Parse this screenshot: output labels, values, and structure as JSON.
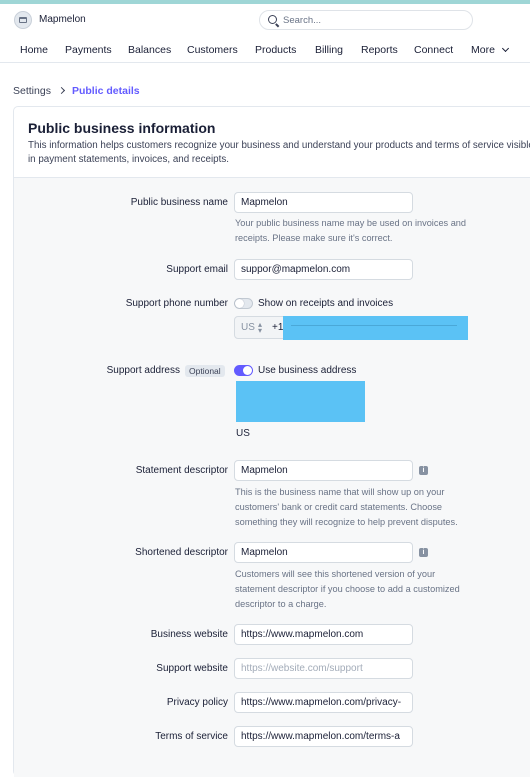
{
  "account": {
    "name": "Mapmelon"
  },
  "search": {
    "placeholder": "Search..."
  },
  "nav": {
    "items": [
      "Home",
      "Payments",
      "Balances",
      "Customers",
      "Products",
      "Billing",
      "Reports",
      "Connect"
    ],
    "more_label": "More"
  },
  "breadcrumb": {
    "parent": "Settings",
    "current": "Public details"
  },
  "card": {
    "title": "Public business information",
    "description": "This information helps customers recognize your business and understand your products and terms of service visible in payment statements, invoices, and receipts."
  },
  "form": {
    "business_name": {
      "label": "Public business name",
      "value": "Mapmelon",
      "help": "Your public business name may be used on invoices and receipts. Please make sure it's correct."
    },
    "support_email": {
      "label": "Support email",
      "value": "suppor@mapmelon.com"
    },
    "support_phone": {
      "label": "Support phone number",
      "toggle_label": "Show on receipts and invoices",
      "toggle_on": false,
      "country": "US",
      "dial_code": "+1"
    },
    "support_address": {
      "label": "Support address",
      "optional_label": "Optional",
      "toggle_label": "Use business address",
      "toggle_on": true,
      "country": "US"
    },
    "statement_descriptor": {
      "label": "Statement descriptor",
      "value": "Mapmelon",
      "help": "This is the business name that will show up on your customers' bank or credit card statements. Choose something they will recognize to help prevent disputes."
    },
    "shortened_descriptor": {
      "label": "Shortened descriptor",
      "value": "Mapmelon",
      "help": "Customers will see this shortened version of your statement descriptor if you choose to add a customized descriptor to a charge."
    },
    "business_website": {
      "label": "Business website",
      "value": "https://www.mapmelon.com"
    },
    "support_website": {
      "label": "Support website",
      "placeholder": "https://website.com/support"
    },
    "privacy_policy": {
      "label": "Privacy policy",
      "value": "https://www.mapmelon.com/privacy-"
    },
    "terms_of_service": {
      "label": "Terms of service",
      "value": "https://www.mapmelon.com/terms-a"
    }
  },
  "colors": {
    "accent": "#635bff",
    "redaction": "#5bc2f5"
  }
}
